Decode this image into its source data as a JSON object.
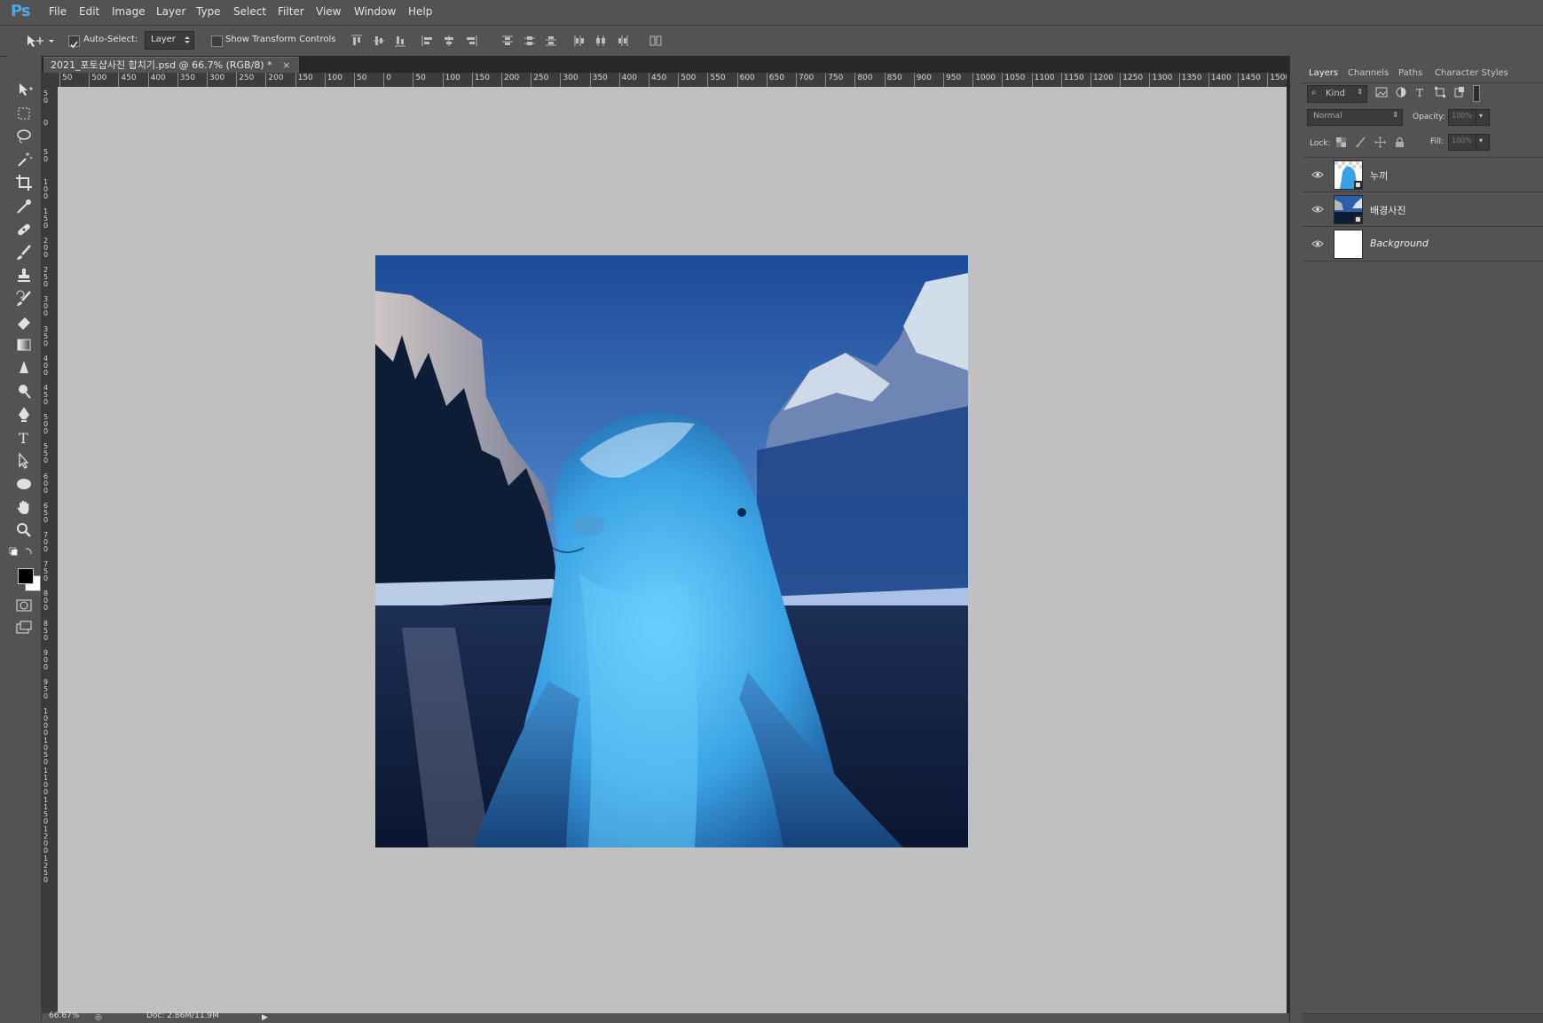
{
  "app": {
    "logo": "Ps"
  },
  "menu": [
    "File",
    "Edit",
    "Image",
    "Layer",
    "Type",
    "Select",
    "Filter",
    "View",
    "Window",
    "Help"
  ],
  "options": {
    "auto_select_label": "Auto-Select:",
    "auto_select_checked": true,
    "auto_select_target": "Layer",
    "show_transform_label": "Show Transform Controls",
    "show_transform_checked": false
  },
  "document": {
    "tab_title": "2021_포토샵사진 합치기.psd @ 66.7% (RGB/8) *",
    "zoom": "66.67%",
    "doc_size": "Doc: 2.86M/11.9M"
  },
  "rulers": {
    "horizontal": [
      "50",
      "500",
      "450",
      "400",
      "350",
      "300",
      "250",
      "200",
      "150",
      "100",
      "50",
      "0",
      "50",
      "100",
      "150",
      "200",
      "250",
      "300",
      "350",
      "400",
      "450",
      "500",
      "550",
      "600",
      "650",
      "700",
      "750",
      "800",
      "850",
      "900",
      "950",
      "1000",
      "1050",
      "1100",
      "1150",
      "1200",
      "1250",
      "1300",
      "1350",
      "1400",
      "1450",
      "1500"
    ],
    "vertical": [
      "50",
      "0",
      "50",
      "100",
      "150",
      "200",
      "250",
      "300",
      "350",
      "400",
      "450",
      "500",
      "550",
      "600",
      "650",
      "700",
      "750",
      "800",
      "850",
      "900",
      "950",
      "1000",
      "1050",
      "1100",
      "1150",
      "1200",
      "1250"
    ]
  },
  "layers_panel": {
    "tabs": [
      "Layers",
      "Channels",
      "Paths",
      "Character Styles"
    ],
    "active_tab": "Layers",
    "filter_kind": "Kind",
    "blend_mode": "Normal",
    "opacity_label": "Opacity:",
    "opacity_value": "100%",
    "lock_label": "Lock:",
    "fill_label": "Fill:",
    "fill_value": "100%",
    "layers": [
      {
        "name": "누끼",
        "visible": true,
        "italic": false
      },
      {
        "name": "배경사진",
        "visible": true,
        "italic": false
      },
      {
        "name": "Background",
        "visible": true,
        "italic": true
      }
    ]
  },
  "colors": {
    "ui_bg": "#535353",
    "canvas_bg": "#c0c0c0",
    "accent": "#4ea7e6"
  }
}
